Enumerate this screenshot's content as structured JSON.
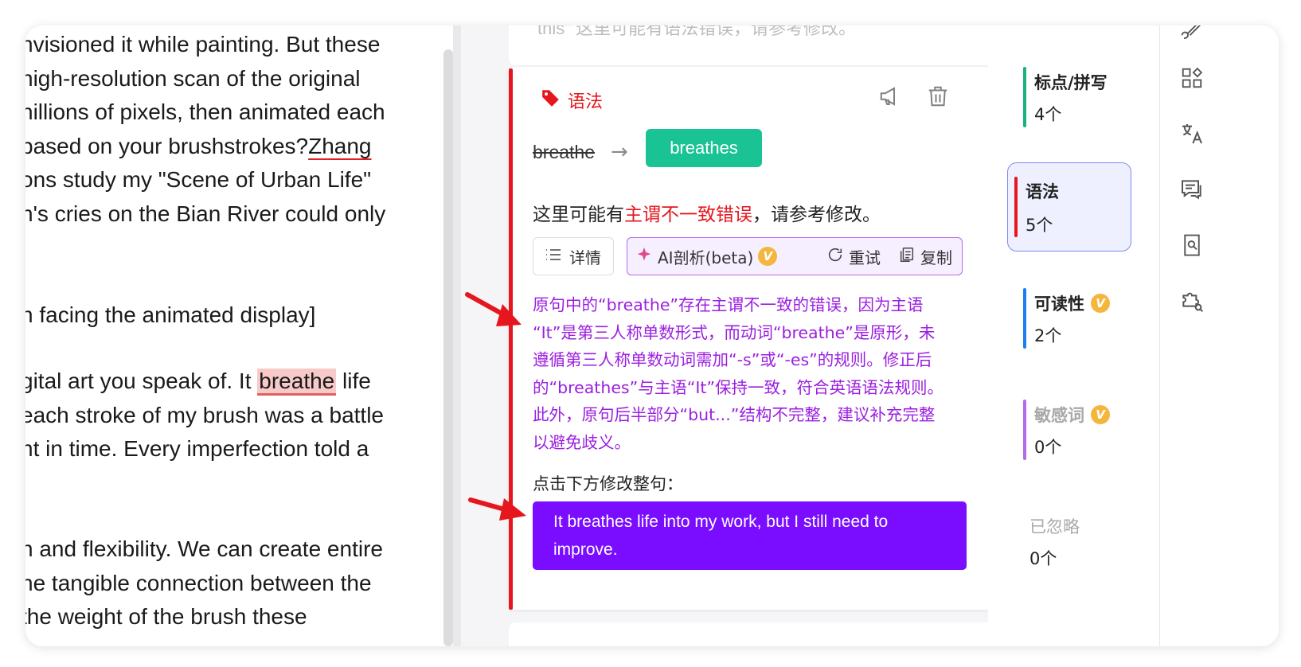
{
  "document": {
    "lines": [
      "nvisioned it while painting. But these",
      " high-resolution scan of the original",
      "nillions of pixels, then animated each",
      " based on your brushstrokes?",
      "ons study my \"Scene of Urban Life\"",
      "n's cries on the Bian River could only",
      "n facing the animated display]",
      "gital art you speak of. It ",
      "each stroke of my brush was a battle",
      "nt in time. Every imperfection told a",
      "n and flexibility. We can create entire",
      "ne tangible connection between the",
      "the weight of the brush   these"
    ],
    "underlined_word": "Zhang",
    "highlighted_word": "breathe",
    "after_highlight": " life"
  },
  "previous_card": {
    "text": "this\" 这里可能有语法错误，请参考修改。"
  },
  "card": {
    "category": "语法",
    "original": "breathe",
    "arrow": "→",
    "suggestion": "breathes",
    "message_pre": "这里可能有",
    "message_red": "主谓不一致错误",
    "message_post": "，请参考修改。",
    "detail_label": "详情",
    "ai_label": "AI剖析(beta)",
    "vip_badge": "V",
    "retry_label": "重试",
    "copy_label": "复制",
    "analysis_lines": [
      "原句中的“breathe”存在主谓不一致的错误，因为主语",
      "“It”是第三人称单数形式，而动词“breathe”是原形，未",
      "遵循第三人称单数动词需加“-s”或“-es”的规则。修正后",
      "的“breathes”与主语“It”保持一致，符合英语语法规则。",
      "此外，原句后半部分“but...”结构不完整，建议补充完整",
      "以避免歧义。"
    ],
    "sentence_prompt": "点击下方修改整句：",
    "sentence_lines": [
      "It breathes life into my work, but I still need to",
      "improve."
    ]
  },
  "categories": [
    {
      "name": "标点/拼写",
      "count": "4个",
      "color": "#19b37a",
      "vip": false
    },
    {
      "name": "语法",
      "count": "5个",
      "color": "#e6161e",
      "vip": false
    },
    {
      "name": "可读性",
      "count": "2个",
      "color": "#1e7ef0",
      "vip": true
    },
    {
      "name": "敏感词",
      "count": "0个",
      "color": "#b36be8",
      "vip": true
    },
    {
      "name": "已忽略",
      "count": "0个",
      "color": "",
      "vip": false
    }
  ],
  "colors": {
    "accent_red": "#e6161e",
    "suggestion_green": "#19c394",
    "ai_purple": "#9b1fe0",
    "sentence_purple": "#7a0cff"
  },
  "icons": {
    "tag": "tag-icon",
    "report": "megaphone-icon",
    "delete": "trash-icon",
    "list": "list-icon",
    "ai": "sparkle-icon",
    "retry": "refresh-icon",
    "copy": "copy-icon",
    "tools": [
      "brush-icon",
      "apps-icon",
      "translate-icon",
      "comment-icon",
      "book-search-icon",
      "puzzle-search-icon"
    ]
  }
}
